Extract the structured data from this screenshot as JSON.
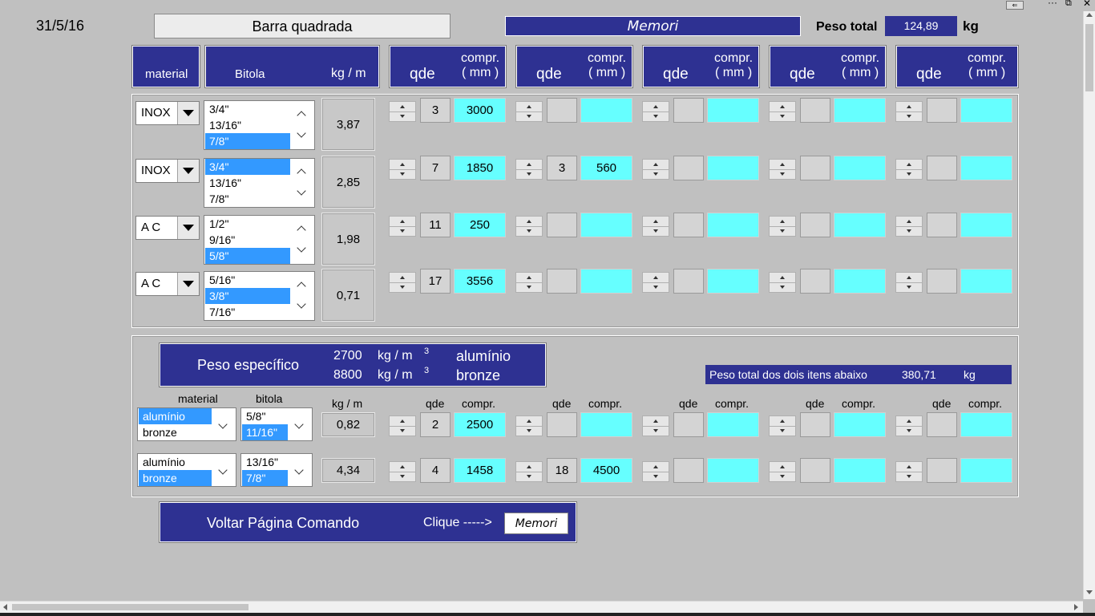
{
  "window": {
    "controls": [
      "restore-icon",
      "more-icon",
      "maximize-icon",
      "close-icon"
    ]
  },
  "date": "31/5/16",
  "title": "Barra quadrada",
  "memori_banner": "Memori",
  "peso_total": {
    "label": "Peso total",
    "value": "124,89",
    "unit": "kg"
  },
  "headers": {
    "material": "material",
    "bitola": "Bitola",
    "kgm": "kg / m",
    "qde": "qde",
    "compr1": "compr.",
    "compr2": "( mm )"
  },
  "rows": [
    {
      "material": "INOX",
      "options": [
        "3/4\"",
        "13/16\"",
        "7/8\""
      ],
      "selected": 2,
      "kgm": "3,87",
      "qde": [
        "3",
        "",
        "",
        "",
        ""
      ],
      "comp": [
        "3000",
        "",
        "",
        "",
        ""
      ]
    },
    {
      "material": "INOX",
      "options": [
        "3/4\"",
        "13/16\"",
        "7/8\""
      ],
      "selected": 0,
      "kgm": "2,85",
      "qde": [
        "7",
        "3",
        "",
        "",
        ""
      ],
      "comp": [
        "1850",
        "560",
        "",
        "",
        ""
      ]
    },
    {
      "material": "A C",
      "options": [
        "1/2\"",
        "9/16\"",
        "5/8\""
      ],
      "selected": 2,
      "kgm": "1,98",
      "qde": [
        "11",
        "",
        "",
        "",
        ""
      ],
      "comp": [
        "250",
        "",
        "",
        "",
        ""
      ]
    },
    {
      "material": "A C",
      "options": [
        "5/16\"",
        "3/8\"",
        "7/16\""
      ],
      "selected": 1,
      "kgm": "0,71",
      "qde": [
        "17",
        "",
        "",
        "",
        ""
      ],
      "comp": [
        "3556",
        "",
        "",
        "",
        ""
      ]
    }
  ],
  "peso_especifico": {
    "label": "Peso específico",
    "line1": {
      "value": "2700",
      "unit": "kg / m",
      "exp": "3",
      "material": "alumínio"
    },
    "line2": {
      "value": "8800",
      "unit": "kg / m",
      "exp": "3",
      "material": "bronze"
    }
  },
  "peso_total_dois": {
    "label": "Peso total dos dois itens abaixo",
    "value": "380,71",
    "unit": "kg"
  },
  "lower_headers": {
    "material": "material",
    "bitola": "bitola",
    "kgm": "kg / m",
    "qde": "qde",
    "compr": "compr."
  },
  "lower_rows": [
    {
      "materials": [
        "alumínio",
        "bronze"
      ],
      "material_selected": 0,
      "bitolas": [
        "5/8\"",
        "11/16\""
      ],
      "bitola_selected": 1,
      "kgm": "0,82",
      "qde": [
        "2",
        "",
        "",
        "",
        ""
      ],
      "comp": [
        "2500",
        "",
        "",
        "",
        ""
      ]
    },
    {
      "materials": [
        "alumínio",
        "bronze"
      ],
      "material_selected": 1,
      "bitolas": [
        "13/16\"",
        "7/8\""
      ],
      "bitola_selected": 1,
      "kgm": "4,34",
      "qde": [
        "4",
        "18",
        "",
        "",
        ""
      ],
      "comp": [
        "1458",
        "4500",
        "",
        "",
        ""
      ]
    }
  ],
  "footer": {
    "voltar": "Voltar Página Comando",
    "clique": "Clique ----->",
    "memori_button": "Memori"
  },
  "colors": {
    "navy": "#2e3192",
    "cyan": "#66ffff",
    "selection": "#3399ff",
    "background": "#c0c0c0"
  }
}
